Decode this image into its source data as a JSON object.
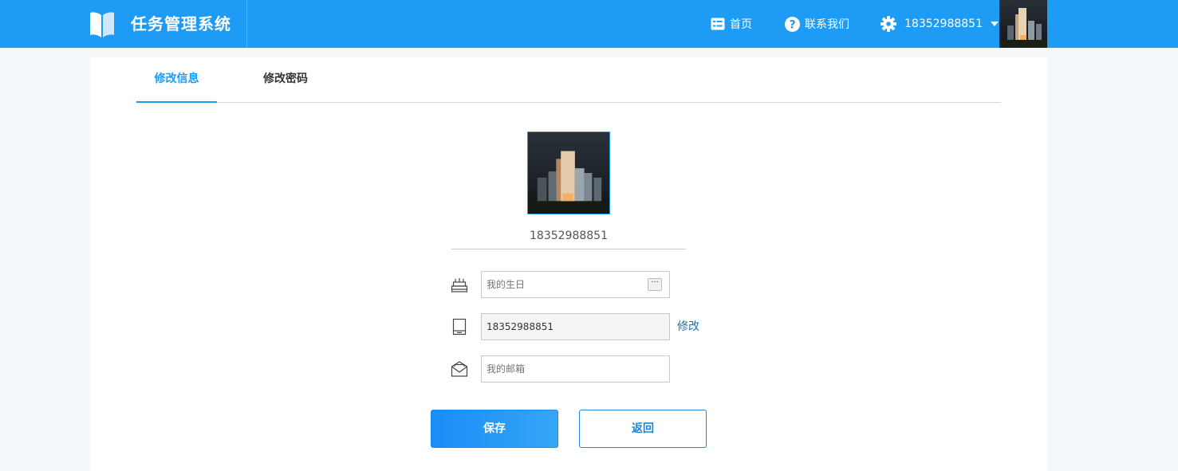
{
  "header": {
    "app_title": "任务管理系统",
    "nav": {
      "home_label": "首页",
      "contact_label": "联系我们",
      "user_label": "18352988851"
    }
  },
  "tabs": [
    {
      "label": "修改信息",
      "active": true
    },
    {
      "label": "修改密码",
      "active": false
    }
  ],
  "profile": {
    "username": "18352988851",
    "birthday_placeholder": "我的生日",
    "birthday_value": "",
    "date_button_label": "···",
    "phone_value": "18352988851",
    "phone_modify_label": "修改",
    "email_placeholder": "我的邮箱",
    "email_value": ""
  },
  "buttons": {
    "save_label": "保存",
    "back_label": "返回"
  },
  "colors": {
    "primary": "#1e9bf5",
    "link": "#1f6fb2"
  },
  "icons": {
    "logo": "book-logo-icon",
    "home": "list-icon",
    "contact": "question-icon",
    "settings": "gear-icon",
    "birthday": "cake-icon",
    "phone": "phone-icon",
    "email": "envelope-icon"
  }
}
